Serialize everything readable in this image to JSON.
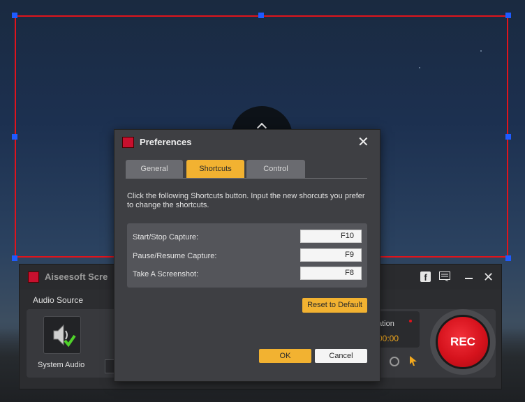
{
  "recorder": {
    "app_title": "Aiseesoft Scre",
    "audio_source_label": "Audio Source",
    "system_audio_label": "System Audio",
    "duration_label": "ation",
    "duration_time": "00:00",
    "rec_label": "REC",
    "facebook_glyph": "f"
  },
  "dialog": {
    "title": "Preferences",
    "close_glyph": "✕",
    "tabs": [
      {
        "label": "General"
      },
      {
        "label": "Shortcuts"
      },
      {
        "label": "Control"
      }
    ],
    "description": "Click the following Shortcuts button. Input the new shorcuts you prefer to change the shortcuts.",
    "shortcuts": [
      {
        "label": "Start/Stop Capture:",
        "key": "F10"
      },
      {
        "label": "Pause/Resume Capture:",
        "key": "F9"
      },
      {
        "label": "Take A Screenshot:",
        "key": "F8"
      }
    ],
    "reset_label": "Reset to Default",
    "ok_label": "OK",
    "cancel_label": "Cancel"
  },
  "colors": {
    "accent": "#f2b231",
    "region_border": "#e0141c",
    "handle": "#1f5bff",
    "rec_red": "#d5121c"
  },
  "icons": [
    "app-logo-icon",
    "facebook-icon",
    "menu-list-icon",
    "minimize-icon",
    "close-icon",
    "speaker-icon",
    "checkmark-icon",
    "alarm-clock-icon",
    "cursor-icon"
  ]
}
